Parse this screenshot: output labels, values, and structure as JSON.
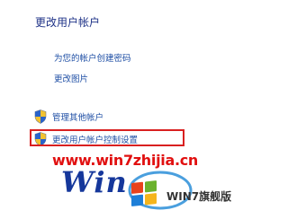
{
  "panel": {
    "title": "更改用户帐户",
    "links": [
      "为您的帐户创建密码",
      "更改图片"
    ],
    "shield_links": [
      "管理其他帐户",
      "更改用户帐户控制设置"
    ]
  },
  "highlight": {
    "color": "#d92020",
    "target": "更改用户帐户控制设置"
  },
  "watermark": {
    "url": "www.win7zhijia.cn",
    "url_color": "#e11010",
    "logo_text": "Win",
    "logo_color": "#15379b",
    "site_name": "WIN7旗舰版"
  },
  "icons": {
    "shield": "uac-shield-icon",
    "windows_logo": "windows-flag-icon"
  }
}
